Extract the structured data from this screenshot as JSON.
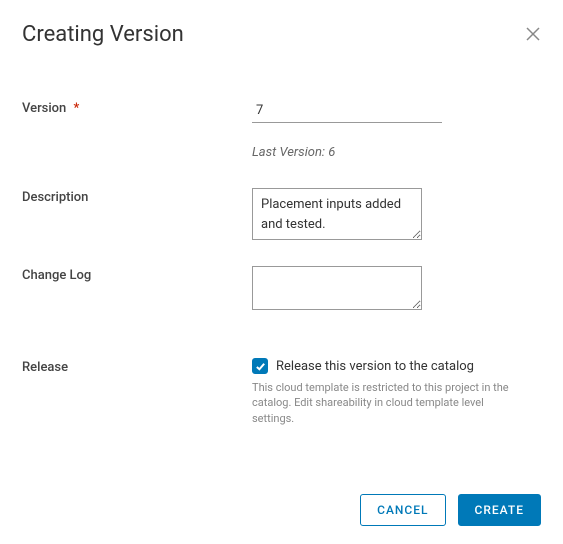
{
  "dialog": {
    "title": "Creating Version"
  },
  "form": {
    "version_label": "Version",
    "version_value": "7",
    "last_version_text": "Last Version: 6",
    "description_label": "Description",
    "description_value": "Placement inputs added and tested.",
    "changelog_label": "Change Log",
    "changelog_value": "",
    "release_label": "Release",
    "release_checkbox_label": "Release this version to the catalog",
    "release_checked": true,
    "release_hint": "This cloud template is restricted to this project in the catalog. Edit shareability in cloud template level settings."
  },
  "footer": {
    "cancel_label": "CANCEL",
    "create_label": "CREATE"
  }
}
